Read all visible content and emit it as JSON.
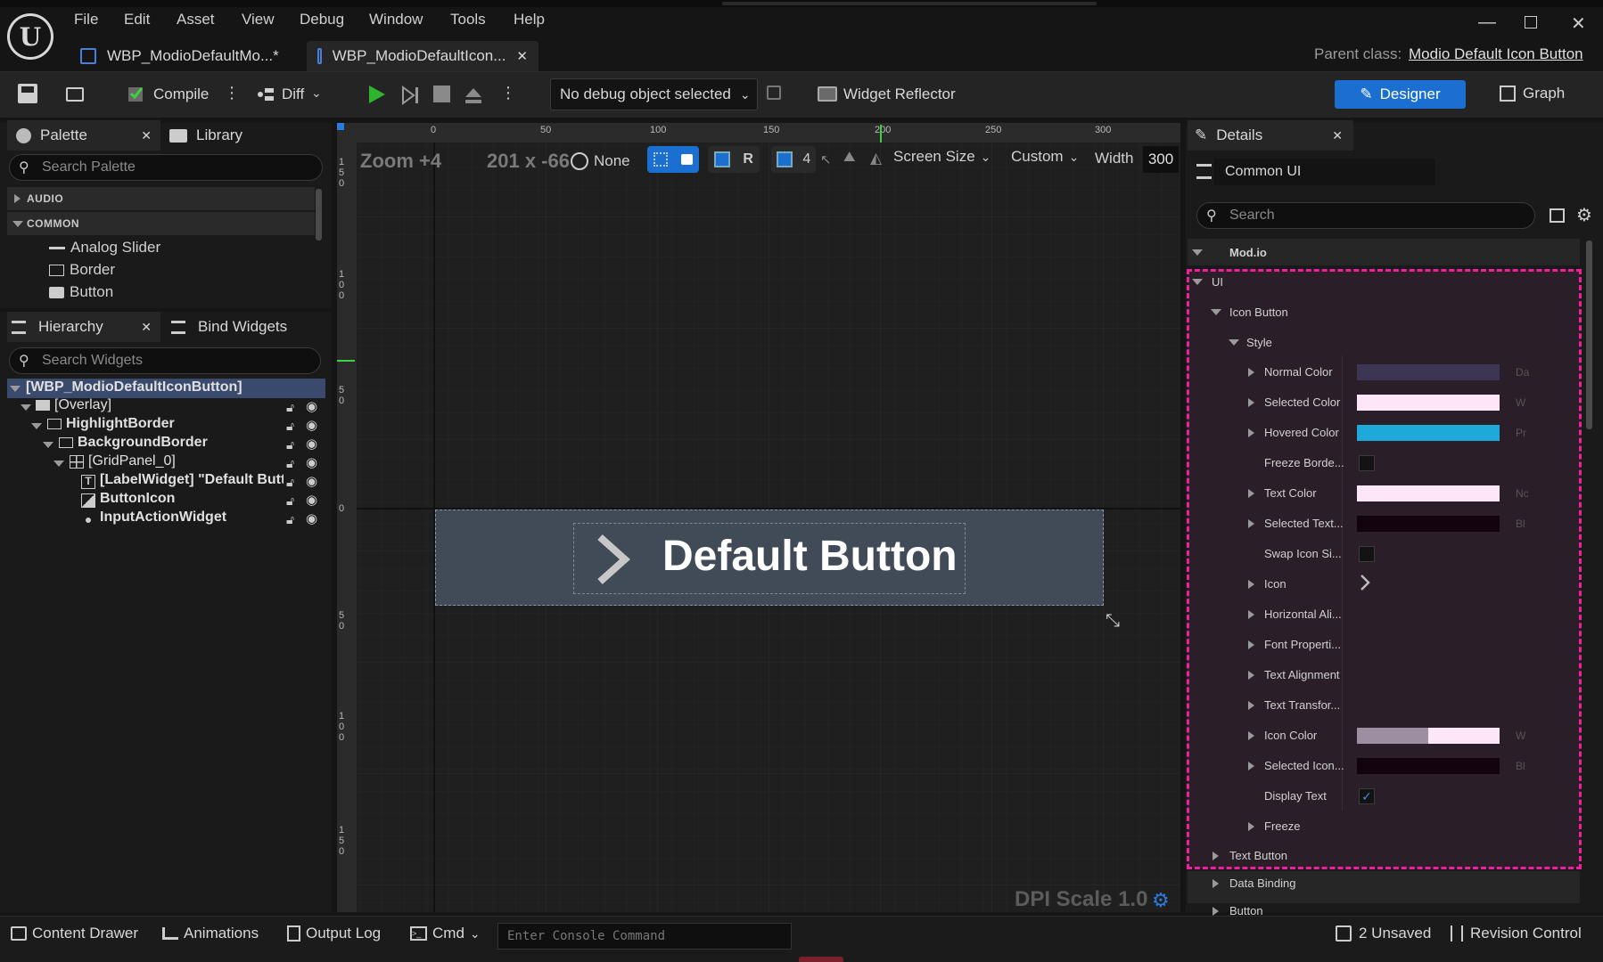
{
  "menu": [
    "File",
    "Edit",
    "Asset",
    "View",
    "Debug",
    "Window",
    "Tools",
    "Help"
  ],
  "tabs": [
    {
      "label": "WBP_ModioDefaultMo...*"
    },
    {
      "label": "WBP_ModioDefaultIcon..."
    }
  ],
  "parent_class": {
    "label": "Parent class:",
    "value": "Modio Default Icon Button"
  },
  "toolbar": {
    "compile": "Compile",
    "diff": "Diff",
    "debug_object": "No debug object selected",
    "widget_reflector": "Widget Reflector",
    "designer": "Designer",
    "graph": "Graph"
  },
  "palette": {
    "tab": "Palette",
    "library_tab": "Library",
    "search_placeholder": "Search Palette",
    "categories": [
      "AUDIO",
      "COMMON"
    ],
    "items": [
      "Analog Slider",
      "Border",
      "Button"
    ]
  },
  "hierarchy": {
    "tab": "Hierarchy",
    "bind_tab": "Bind Widgets",
    "search_placeholder": "Search Widgets",
    "root": "[WBP_ModioDefaultIconButton]",
    "items": [
      "[Overlay]",
      "HighlightBorder",
      "BackgroundBorder",
      "[GridPanel_0]",
      "[LabelWidget] \"Default Butt",
      "ButtonIcon",
      "InputActionWidget"
    ]
  },
  "viewport": {
    "zoom": "Zoom +4",
    "size": "201 x -66",
    "none": "None",
    "r_label": "R",
    "grid_num": "4",
    "screen_size": "Screen Size",
    "custom": "Custom",
    "width_label": "Width",
    "width_value": "300",
    "ruler_top": [
      "0",
      "50",
      "100",
      "150",
      "200",
      "250",
      "300"
    ],
    "ruler_left": [
      "1\n5\n0",
      "1\n0\n0",
      "5\n0",
      "0",
      "5\n0",
      "1\n0\n0",
      "1\n5\n0"
    ],
    "button_text": "Default Button",
    "dpi": "DPI Scale 1.0"
  },
  "details": {
    "tab": "Details",
    "class_name": "Common UI",
    "search_placeholder": "Search",
    "sections": {
      "modio": "Mod.io",
      "ui": "UI",
      "icon_button": "Icon Button",
      "style": "Style",
      "text_button": "Text Button",
      "data_binding": "Data Binding",
      "button": "Button"
    },
    "props": [
      {
        "label": "Normal Color",
        "trunc": "Da"
      },
      {
        "label": "Selected Color",
        "trunc": "W"
      },
      {
        "label": "Hovered Color",
        "trunc": "Pr"
      },
      {
        "label": "Freeze Borde...",
        "trunc": ""
      },
      {
        "label": "Text Color",
        "trunc": "Nc"
      },
      {
        "label": "Selected Text...",
        "trunc": "Bl"
      },
      {
        "label": "Swap Icon Si...",
        "trunc": ""
      },
      {
        "label": "Icon",
        "trunc": ""
      },
      {
        "label": "Horizontal Ali...",
        "trunc": ""
      },
      {
        "label": "Font Properti...",
        "trunc": ""
      },
      {
        "label": "Text Alignment",
        "trunc": ""
      },
      {
        "label": "Text Transfor...",
        "trunc": ""
      },
      {
        "label": "Icon Color",
        "trunc": "W"
      },
      {
        "label": "Selected Icon...",
        "trunc": "Bl"
      },
      {
        "label": "Display Text",
        "trunc": ""
      },
      {
        "label": "Freeze",
        "trunc": ""
      }
    ],
    "colors": {
      "normal": "#3d3554",
      "selected": "#fde6f8",
      "hovered": "#1ea9d9",
      "text": "#fde6f8",
      "selected_text": "#12030f",
      "icon_left": "#9e8ea2",
      "icon_right": "#fde6f8",
      "selected_icon": "#12030f"
    }
  },
  "bottom": {
    "content_drawer": "Content Drawer",
    "animations": "Animations",
    "output_log": "Output Log",
    "cmd": "Cmd",
    "console_placeholder": "Enter Console Command",
    "unsaved": "2 Unsaved",
    "revision": "Revision Control"
  }
}
